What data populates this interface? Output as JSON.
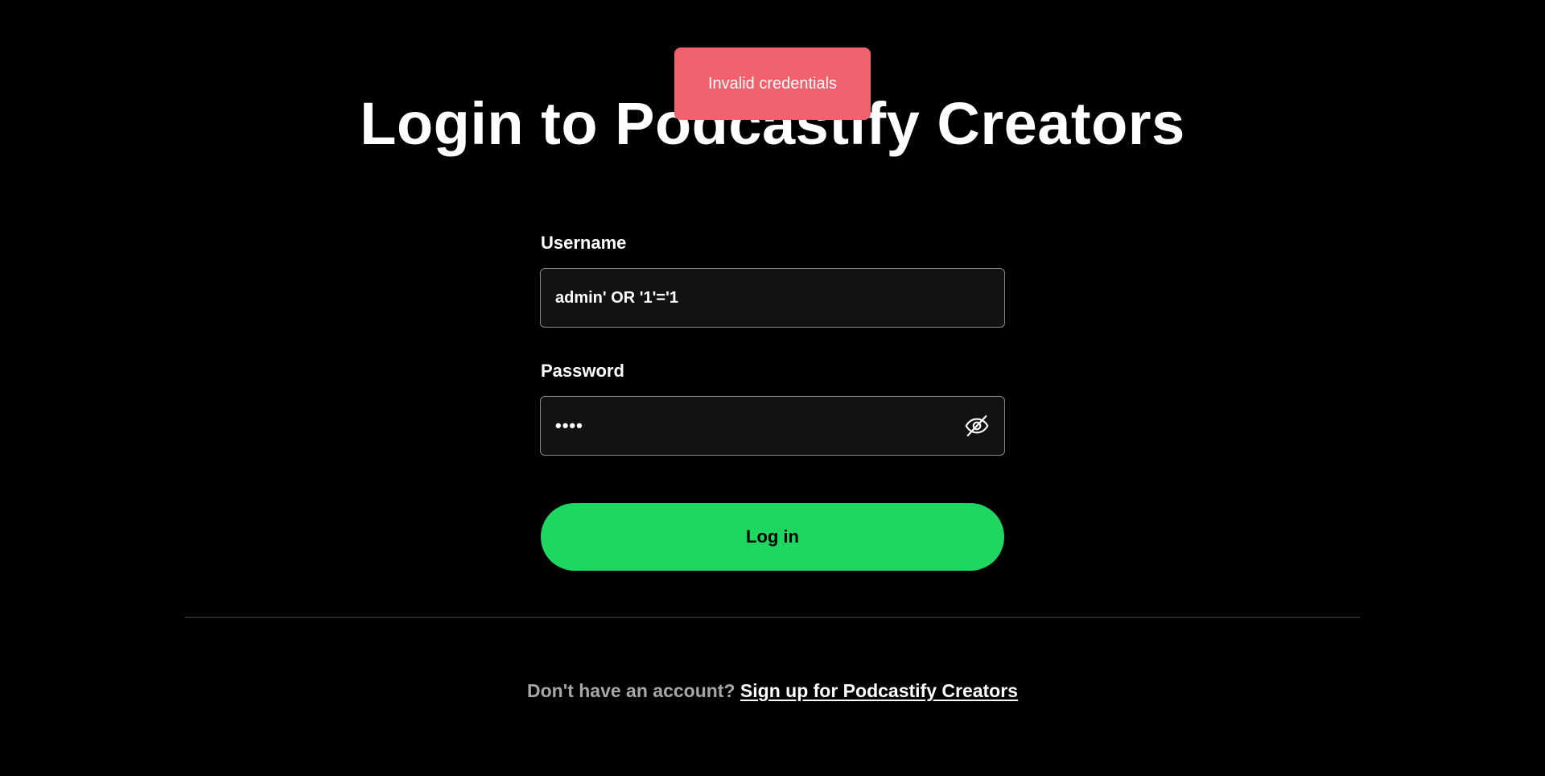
{
  "toast": {
    "message": "Invalid credentials",
    "color": "#f0626e"
  },
  "page": {
    "title": "Login to Podcastify Creators"
  },
  "form": {
    "username": {
      "label": "Username",
      "value": "admin' OR '1'='1"
    },
    "password": {
      "label": "Password",
      "value": "test",
      "masked": "••••",
      "toggle_icon": "eye-off-icon"
    },
    "submit_label": "Log in",
    "accent_color": "#1ed760"
  },
  "footer": {
    "prompt": "Don't have an account?",
    "signup_link": "Sign up for Podcastify Creators"
  }
}
